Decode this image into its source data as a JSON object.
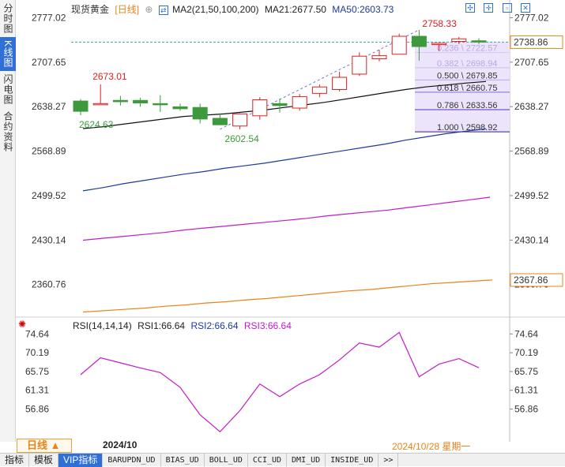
{
  "left_tabs": [
    "分时图",
    "K线图",
    "闪电图",
    "合约资料"
  ],
  "active_left_tab": 1,
  "header": {
    "title": "现货黄金",
    "period": "[日线]",
    "ma_label": "MA2(21,50,100,200)",
    "ma21": "MA21:2677.50",
    "ma50": "MA50:2603.73"
  },
  "icons": [
    "expand-icon",
    "crosshair-icon",
    "fit-icon",
    "close-icon"
  ],
  "price_axis": [
    "2777.02",
    "2707.65",
    "2638.27",
    "2568.89",
    "2499.52",
    "2430.14",
    "2360.76"
  ],
  "last_price": "2738.86",
  "ma200_label": "2367.86",
  "rsi_axis": [
    "74.64",
    "70.19",
    "65.75",
    "61.31",
    "56.86"
  ],
  "rsi_legend": {
    "label": "RSI(14,14,14)",
    "rsi1": "RSI1:66.64",
    "rsi2": "RSI2:66.64",
    "rsi3": "RSI3:66.64"
  },
  "annotations": {
    "high": "2758.33",
    "mid_high": "2673.01",
    "low_a": "2624.63",
    "low_b": "2602.54"
  },
  "fib_levels": [
    {
      "label": "0.236 \\ 2722.57"
    },
    {
      "label": "0.382 \\ 2698.94"
    },
    {
      "label": "0.500 \\ 2679.85"
    },
    {
      "label": "0.618 \\ 2660.75"
    },
    {
      "label": "0.786 \\ 2633.56"
    },
    {
      "label": "1.000 \\ 2598.92"
    }
  ],
  "period_button": "日线 ▲",
  "date_left": "2024/10",
  "date_right": "2024/10/28 星期一",
  "bottom_tabs": [
    "指标",
    "模板",
    "VIP指标",
    "BARUPDN_UD",
    "BIAS_UD",
    "BOLL_UD",
    "CCI_UD",
    "DMI_UD",
    "INSIDE_UD",
    ">>"
  ],
  "active_bottom_tab": 2,
  "colors": {
    "up": "#e02020",
    "down": "#3c9a3c",
    "ma21": "#111111",
    "ma50": "#1f3a9b",
    "ma100": "#c21bc8",
    "ma200": "#e8841a",
    "rsi": "#c21bc8"
  },
  "chart_data": {
    "type": "candlestick",
    "ohlc": [
      {
        "o": 2647.0,
        "h": 2650.0,
        "l": 2625.0,
        "c": 2631.0
      },
      {
        "o": 2643.0,
        "h": 2673.0,
        "l": 2643.0,
        "c": 2643.0
      },
      {
        "o": 2648.0,
        "h": 2655.0,
        "l": 2640.0,
        "c": 2646.0
      },
      {
        "o": 2648.0,
        "h": 2652.0,
        "l": 2638.0,
        "c": 2644.0
      },
      {
        "o": 2643.0,
        "h": 2656.0,
        "l": 2630.0,
        "c": 2642.0
      },
      {
        "o": 2638.0,
        "h": 2643.0,
        "l": 2632.0,
        "c": 2635.0
      },
      {
        "o": 2637.0,
        "h": 2643.0,
        "l": 2612.0,
        "c": 2619.0
      },
      {
        "o": 2620.0,
        "h": 2628.0,
        "l": 2610.0,
        "c": 2610.0
      },
      {
        "o": 2608.0,
        "h": 2628.0,
        "l": 2603.0,
        "c": 2627.0
      },
      {
        "o": 2624.0,
        "h": 2653.0,
        "l": 2618.0,
        "c": 2649.0
      },
      {
        "o": 2643.0,
        "h": 2651.0,
        "l": 2629.0,
        "c": 2640.0
      },
      {
        "o": 2636.0,
        "h": 2658.0,
        "l": 2632.0,
        "c": 2654.0
      },
      {
        "o": 2659.0,
        "h": 2673.0,
        "l": 2653.0,
        "c": 2669.0
      },
      {
        "o": 2665.0,
        "h": 2693.0,
        "l": 2662.0,
        "c": 2684.0
      },
      {
        "o": 2689.0,
        "h": 2723.0,
        "l": 2686.0,
        "c": 2717.0
      },
      {
        "o": 2713.0,
        "h": 2727.0,
        "l": 2709.0,
        "c": 2718.0
      },
      {
        "o": 2720.0,
        "h": 2752.0,
        "l": 2720.0,
        "c": 2748.0
      },
      {
        "o": 2748.0,
        "h": 2758.0,
        "l": 2710.0,
        "c": 2732.0
      },
      {
        "o": 2735.0,
        "h": 2738.0,
        "l": 2725.0,
        "c": 2737.0
      },
      {
        "o": 2740.0,
        "h": 2747.0,
        "l": 2736.0,
        "c": 2744.0
      },
      {
        "o": 2741.0,
        "h": 2745.0,
        "l": 2736.0,
        "c": 2739.0
      }
    ],
    "ma21": [
      2604,
      2607,
      2611,
      2615,
      2619,
      2623,
      2625,
      2627,
      2630,
      2633,
      2637,
      2641,
      2645,
      2650,
      2655,
      2660,
      2665,
      2669,
      2672,
      2675,
      2677.5
    ],
    "ma50": [
      2507,
      2512,
      2518,
      2523,
      2528,
      2533,
      2537,
      2542,
      2546,
      2550,
      2555,
      2560,
      2565,
      2570,
      2575,
      2580,
      2586,
      2591,
      2596,
      2600,
      2603.7
    ],
    "ma100": [
      2430,
      2433,
      2436,
      2439,
      2442,
      2446,
      2449,
      2452,
      2455,
      2458,
      2461,
      2464,
      2468,
      2471,
      2474,
      2477,
      2481,
      2485,
      2489,
      2493,
      2497
    ],
    "ma200": [
      2318,
      2320,
      2322,
      2324,
      2327,
      2329,
      2332,
      2334,
      2337,
      2339,
      2342,
      2345,
      2348,
      2351,
      2353,
      2356,
      2359,
      2362,
      2364,
      2366,
      2367.9
    ],
    "rsi": [
      65.0,
      69.0,
      67.8,
      66.6,
      65.5,
      62.0,
      55.5,
      51.5,
      56.5,
      62.8,
      59.8,
      62.8,
      65.0,
      68.5,
      72.5,
      71.5,
      75.0,
      64.5,
      67.5,
      68.8,
      66.64
    ],
    "price_range": [
      2310,
      2780
    ],
    "rsi_range": [
      51,
      76
    ],
    "x_labels": [
      "2024/10",
      "2024/10/28 星期一"
    ]
  }
}
